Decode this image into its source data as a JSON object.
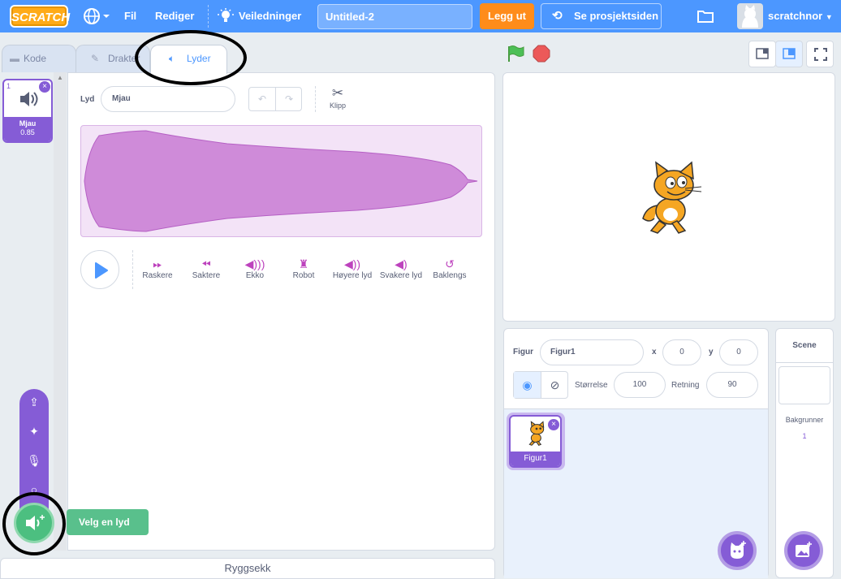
{
  "menu": {
    "logo": "SCRATCH",
    "file": "Fil",
    "edit": "Rediger",
    "tutorials": "Veiledninger",
    "project_title": "Untitled-2",
    "share": "Legg ut",
    "see_project": "Se prosjektsiden",
    "username": "scratchnor"
  },
  "tabs": {
    "code": "Kode",
    "costumes": "Drakter",
    "sounds": "Lyder"
  },
  "sound_list": [
    {
      "index": "1",
      "name": "Mjau",
      "duration": "0.85"
    }
  ],
  "editor": {
    "sound_label": "Lyd",
    "sound_name": "Mjau",
    "trim": "Klipp",
    "effects": [
      "Raskere",
      "Saktere",
      "Ekko",
      "Robot",
      "Høyere lyd",
      "Svakere lyd",
      "Baklengs"
    ]
  },
  "backpack": "Ryggsekk",
  "add_sound_tooltip": "Velg en lyd",
  "sprite_info": {
    "sprite_label": "Figur",
    "sprite_name": "Figur1",
    "x_label": "x",
    "x": "0",
    "y_label": "y",
    "y": "0",
    "size_label": "Størrelse",
    "size": "100",
    "direction_label": "Retning",
    "direction": "90"
  },
  "sprites": [
    {
      "name": "Figur1"
    }
  ],
  "stage": {
    "title": "Scene",
    "backdrops_label": "Bakgrunner",
    "backdrop_count": "1"
  },
  "colors": {
    "menu": "#4c97ff",
    "accent": "#855cd6",
    "share": "#ff8c1a",
    "sound": "#bd42bd",
    "add": "#4cbf80"
  }
}
